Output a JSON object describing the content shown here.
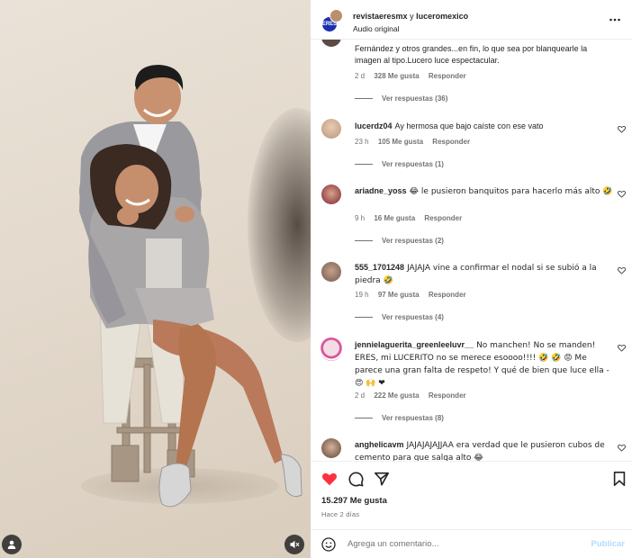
{
  "header": {
    "account": "revistaeresmx",
    "connector": " y ",
    "coauthor": "luceromexico",
    "audio": "Audio original",
    "avatar_text": "ERES"
  },
  "comments": [
    {
      "user": "",
      "text": "Fernández y otros grandes...en fin, lo que sea por blanquearle la imagen al tipo.Lucero luce espectacular.",
      "time": "2 d",
      "likes": "328 Me gusta",
      "reply": "Responder",
      "replies": "Ver respuestas (36)"
    },
    {
      "user": "lucerdz04",
      "text": "Ay hermosa que bajo caíste con ese vato",
      "time": "23 h",
      "likes": "105 Me gusta",
      "reply": "Responder",
      "replies": "Ver respuestas (1)"
    },
    {
      "user": "ariadne_yoss",
      "text": "😂 le pusieron banquitos para hacerlo más alto 🤣",
      "time": "9 h",
      "likes": "16 Me gusta",
      "reply": "Responder",
      "replies": "Ver respuestas (2)"
    },
    {
      "user": "555_1701248",
      "text": "JAJAJA vine a confirmar el nodal si se subió a la piedra 🤣",
      "time": "19 h",
      "likes": "97 Me gusta",
      "reply": "Responder",
      "replies": "Ver respuestas (4)"
    },
    {
      "user": "jennielaguerita_greenleeluvr__",
      "text": "No manchen! No se manden! ERES, mi LUCERITO no se merece esoooo!!!! 🤣 🤣 😡 Me parece una gran falta de respeto! Y qué de bien que luce ella - 😍 🙌 ❤",
      "time": "2 d",
      "likes": "222 Me gusta",
      "reply": "Responder",
      "replies": "Ver respuestas (8)"
    },
    {
      "user": "anghelicavm",
      "text": "JAJAJAJAJJAA era verdad que le pusieron cubos de cemento para que salga alto 😂",
      "time": "",
      "likes": "",
      "reply": "",
      "replies": ""
    }
  ],
  "actions": {
    "likes": "15.297 Me gusta",
    "time": "Hace 2 días"
  },
  "composer": {
    "placeholder": "Agrega un comentario...",
    "publish": "Publicar"
  },
  "colors": {
    "like_red": "#ff3040",
    "publish_blue": "#b3dbff",
    "brand_blue": "#1d2fb0"
  },
  "icons": [
    "user-icon",
    "mute-icon",
    "more-icon",
    "heart-icon",
    "comment-icon",
    "share-icon",
    "bookmark-icon",
    "emoji-icon"
  ]
}
